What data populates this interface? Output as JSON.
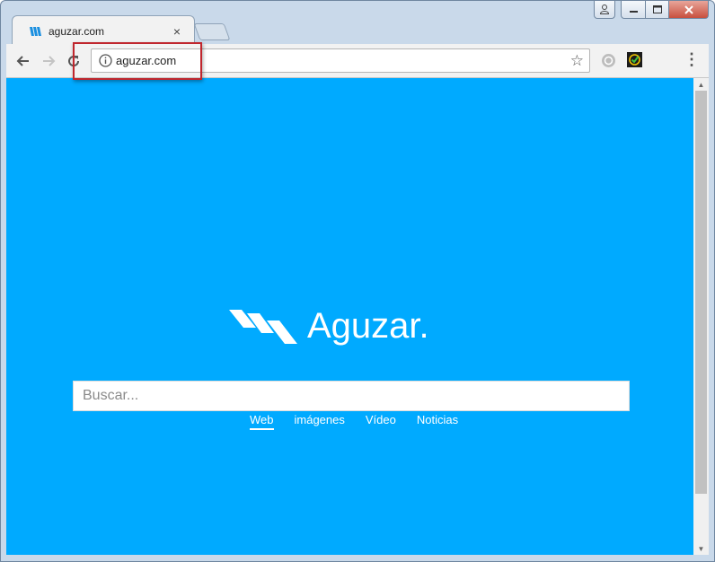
{
  "browser": {
    "tab": {
      "title": "aguzar.com",
      "close_glyph": "×",
      "favicon": "aguzar-favicon-icon"
    },
    "new_tab": "new-tab-button",
    "window_controls": {
      "user": "user-icon",
      "minimize": "minimize-icon",
      "maximize": "maximize-icon",
      "close": "close-icon"
    },
    "address_bar": {
      "url": "aguzar.com",
      "info_icon": "info-icon",
      "bookmark_icon": "star-icon"
    },
    "extensions": [
      "extension-shield-icon",
      "extension-check-icon"
    ],
    "menu_icon": "kebab-menu-icon"
  },
  "page": {
    "logo_text": "Aguzar.",
    "search": {
      "placeholder": "Buscar..."
    },
    "tabs": [
      {
        "label": "Web",
        "active": true
      },
      {
        "label": "imágenes",
        "active": false
      },
      {
        "label": "Vídeo",
        "active": false
      },
      {
        "label": "Noticias",
        "active": false
      }
    ]
  },
  "colors": {
    "page_background": "#00aaff",
    "highlight_box": "#c0262d"
  }
}
